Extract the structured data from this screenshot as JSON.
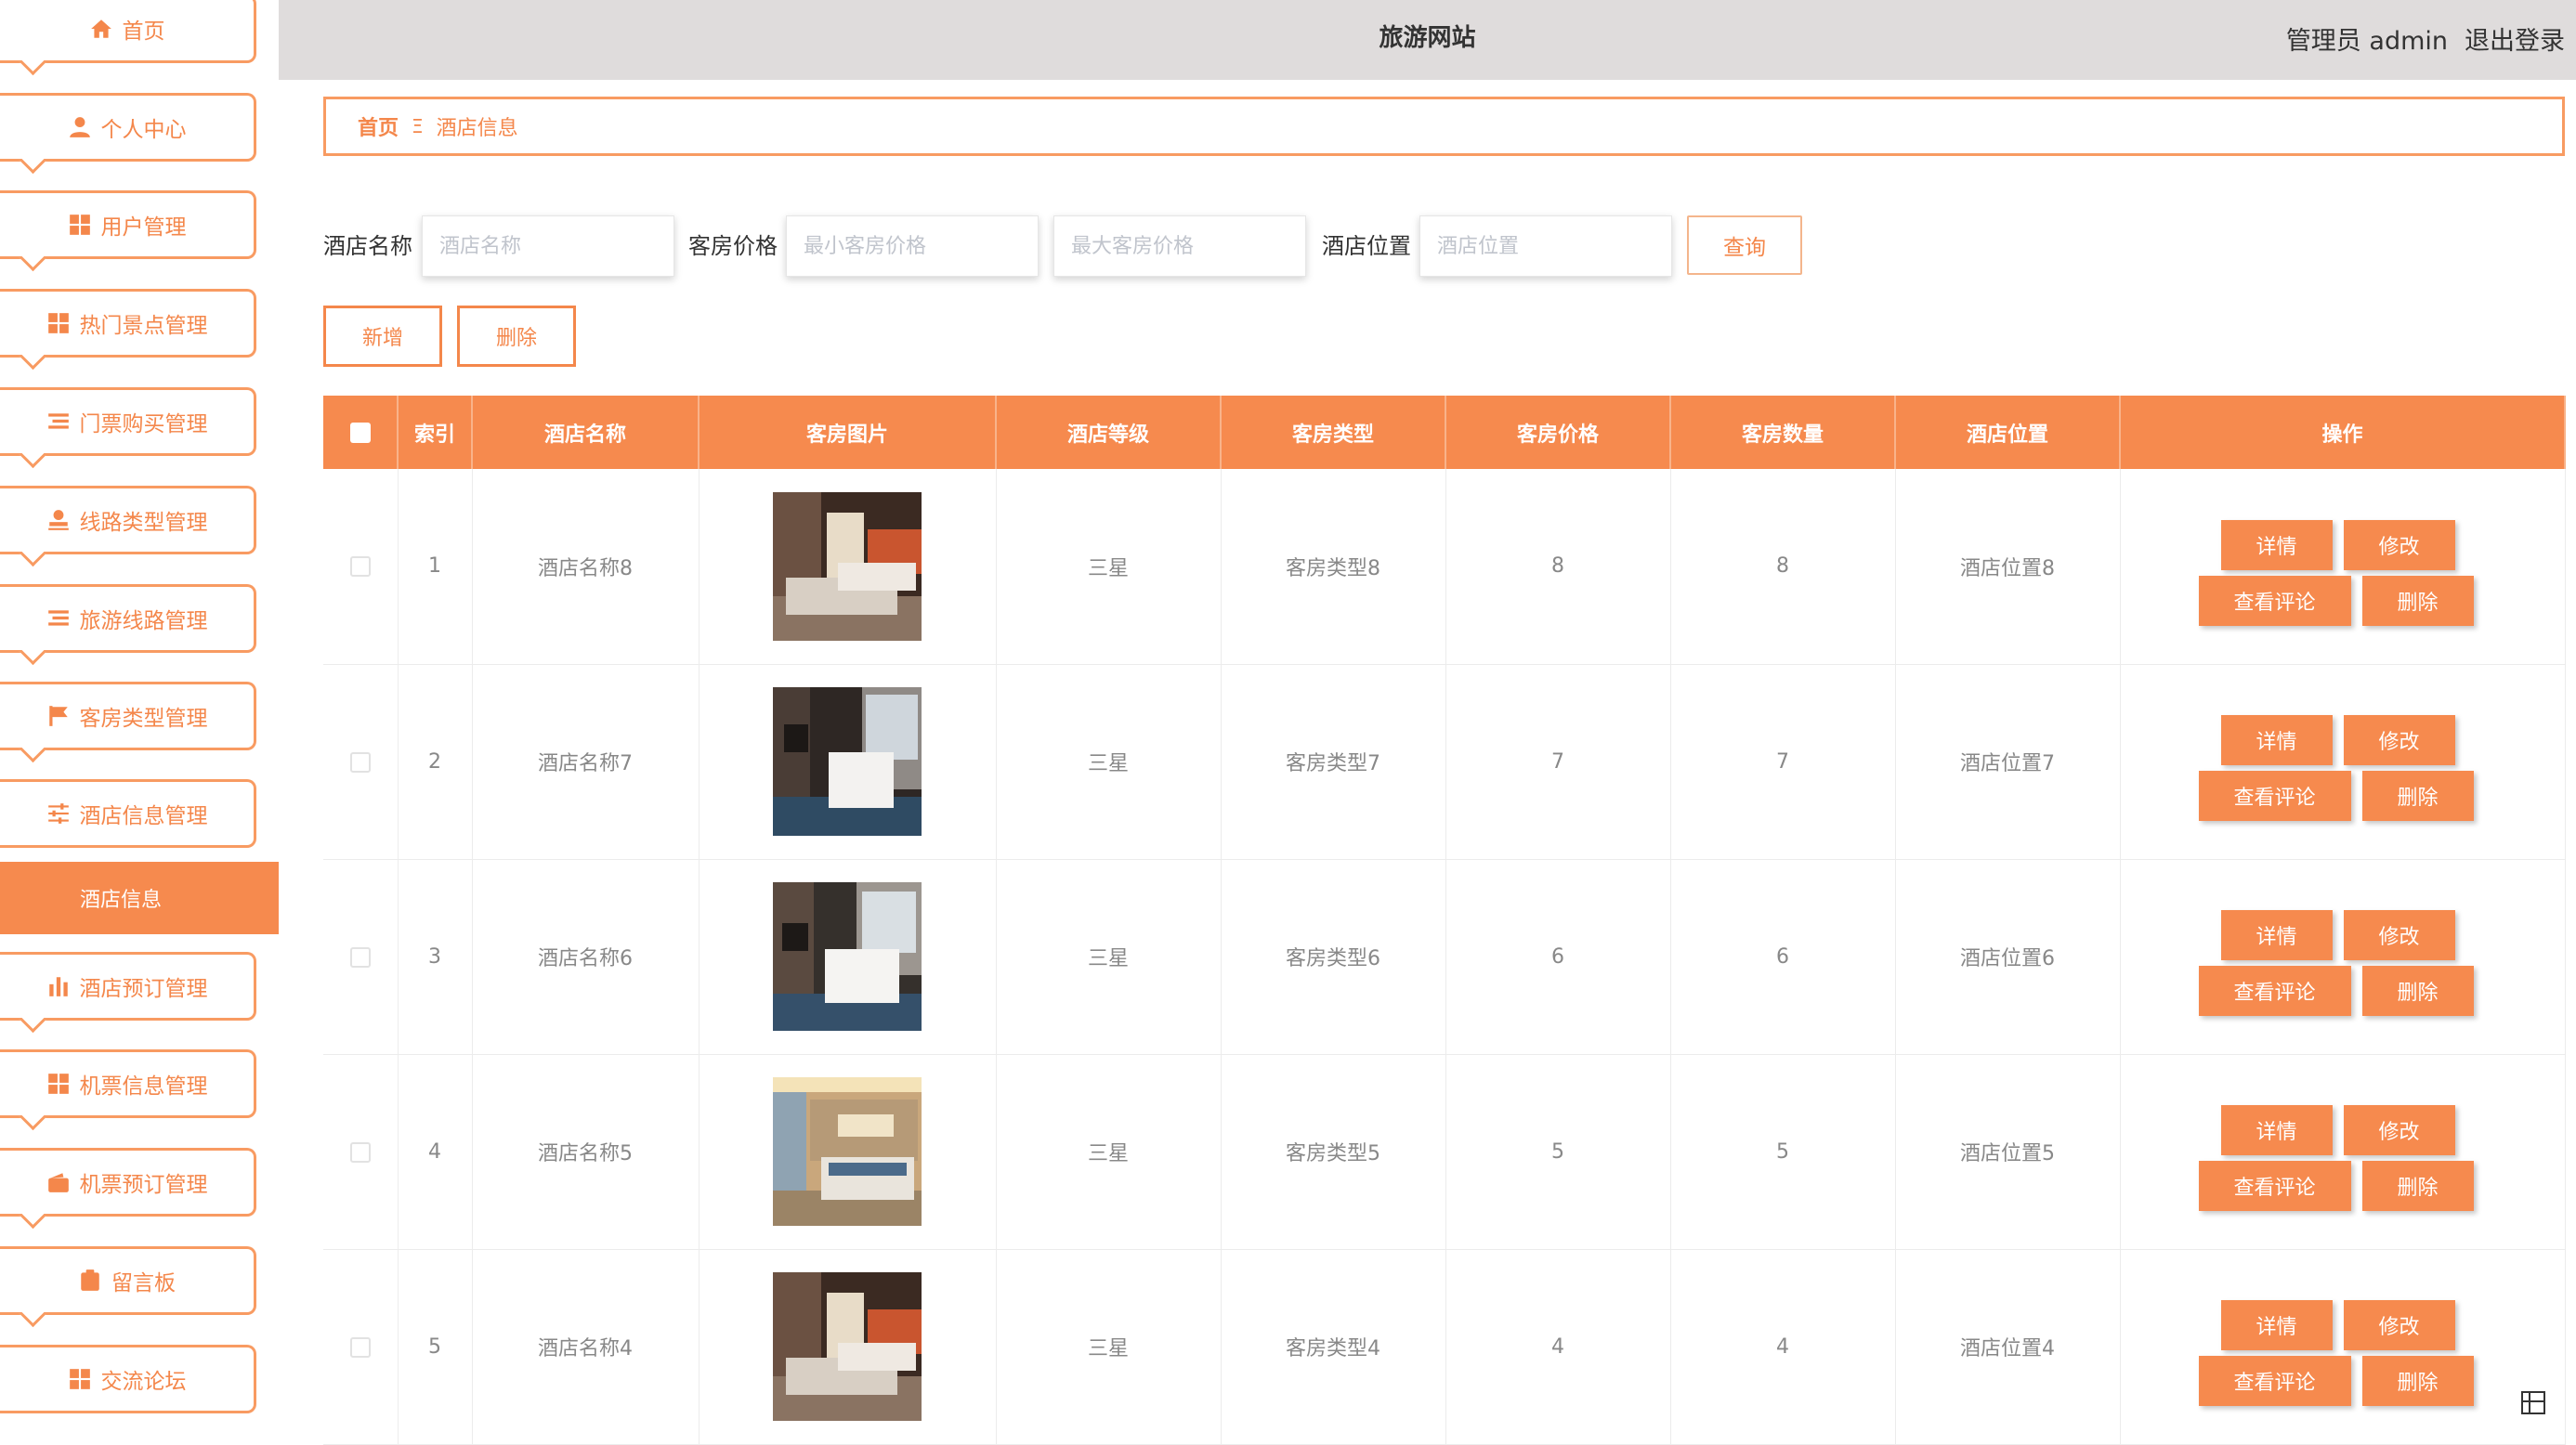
{
  "header": {
    "title": "旅游网站",
    "user": "管理员 admin",
    "logout": "退出登录"
  },
  "sidebar": {
    "items": [
      {
        "label": "首页",
        "icon": "home-icon"
      },
      {
        "label": "个人中心",
        "icon": "person-icon"
      },
      {
        "label": "用户管理",
        "icon": "grid-icon"
      },
      {
        "label": "热门景点管理",
        "icon": "grid-icon"
      },
      {
        "label": "门票购买管理",
        "icon": "list-icon"
      },
      {
        "label": "线路类型管理",
        "icon": "user-stamp-icon"
      },
      {
        "label": "旅游线路管理",
        "icon": "list-icon"
      },
      {
        "label": "客房类型管理",
        "icon": "flag-icon"
      },
      {
        "label": "酒店信息管理",
        "icon": "sliders-icon"
      },
      {
        "label": "酒店预订管理",
        "icon": "bar-chart-icon"
      },
      {
        "label": "机票信息管理",
        "icon": "grid-icon"
      },
      {
        "label": "机票预订管理",
        "icon": "wallet-icon"
      },
      {
        "label": "留言板",
        "icon": "clipboard-icon"
      },
      {
        "label": "交流论坛",
        "icon": "grid-icon"
      }
    ],
    "active_sub": "酒店信息"
  },
  "breadcrumb": {
    "home": "首页",
    "separator": "Ξ",
    "current": "酒店信息"
  },
  "search": {
    "name_label": "酒店名称",
    "name_placeholder": "酒店名称",
    "price_label": "客房价格",
    "min_price_placeholder": "最小客房价格",
    "max_price_placeholder": "最大客房价格",
    "location_label": "酒店位置",
    "location_placeholder": "酒店位置",
    "query_label": "查询"
  },
  "actions": {
    "add_label": "新增",
    "delete_label": "删除"
  },
  "table": {
    "columns": [
      "索引",
      "酒店名称",
      "客房图片",
      "酒店等级",
      "客房类型",
      "客房价格",
      "客房数量",
      "酒店位置",
      "操作"
    ],
    "rows": [
      {
        "index": "1",
        "name": "酒店名称8",
        "level": "三星",
        "room_type": "客房类型8",
        "price": "8",
        "count": "8",
        "location": "酒店位置8"
      },
      {
        "index": "2",
        "name": "酒店名称7",
        "level": "三星",
        "room_type": "客房类型7",
        "price": "7",
        "count": "7",
        "location": "酒店位置7"
      },
      {
        "index": "3",
        "name": "酒店名称6",
        "level": "三星",
        "room_type": "客房类型6",
        "price": "6",
        "count": "6",
        "location": "酒店位置6"
      },
      {
        "index": "4",
        "name": "酒店名称5",
        "level": "三星",
        "room_type": "客房类型5",
        "price": "5",
        "count": "5",
        "location": "酒店位置5"
      },
      {
        "index": "5",
        "name": "酒店名称4",
        "level": "三星",
        "room_type": "客房类型4",
        "price": "4",
        "count": "4",
        "location": "酒店位置4"
      }
    ],
    "op_labels": {
      "detail": "详情",
      "edit": "修改",
      "comments": "查看评论",
      "delete": "删除"
    }
  },
  "colors": {
    "accent": "#f68a4e",
    "accent_border": "#f89b62",
    "header_bg": "#dfdcdc"
  }
}
